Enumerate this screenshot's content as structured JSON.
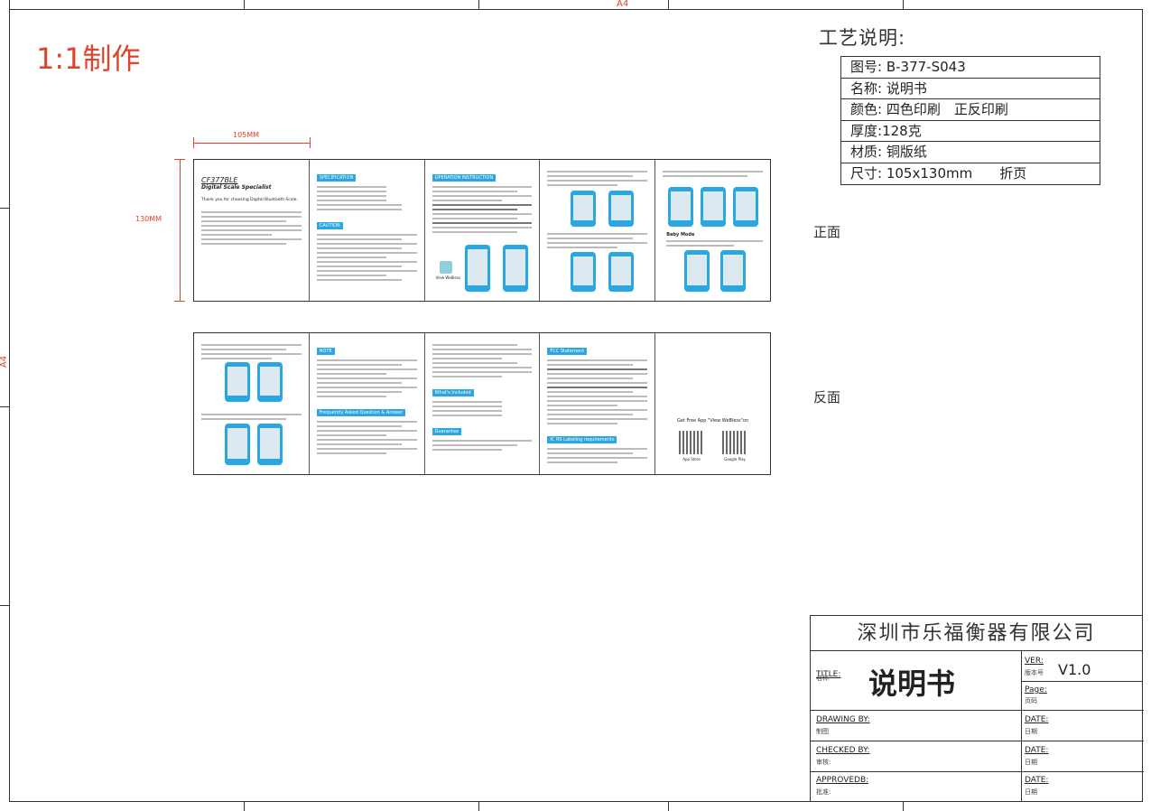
{
  "sheet": {
    "size_marker": "A4",
    "instruction_red": "1:1制作",
    "dim_width": "105MM",
    "dim_height": "130MM"
  },
  "craft": {
    "title": "工艺说明:",
    "rows": [
      {
        "label": "图号:",
        "value": "B-377-S043"
      },
      {
        "label": "名称:",
        "value": "说明书"
      },
      {
        "label": "颜色:",
        "value": "四色印刷　正反印刷"
      },
      {
        "label": "厚度:",
        "value": "128克"
      },
      {
        "label": "材质:",
        "value": "铜版纸"
      },
      {
        "label": "尺寸:",
        "value": "105x130mm　　折页"
      }
    ]
  },
  "sides": {
    "front": "正面",
    "back": "反面"
  },
  "brochure_front": {
    "panel1": {
      "model": "CF377BLE",
      "subtitle": "Digital Scale Specialist",
      "thanks": "Thank you for choosing Digital Bluetooth Scale."
    },
    "panel2": {
      "h1": "SPECIFICATION",
      "h2": "CAUTION"
    },
    "panel3": {
      "h1": "OPERATION INSTRUCTION",
      "app_label": "View WeBless"
    },
    "panel4": {},
    "panel5": {
      "h1": "Baby Mode"
    }
  },
  "brochure_back": {
    "panel2": {
      "h1": "NOTE",
      "h2": "Frequently Asked Question & Answer"
    },
    "panel3": {
      "h1": "What's Included",
      "h2": "Guarantee"
    },
    "panel4": {
      "h1": "FCC Statement",
      "h2": "IC RS Labeling requirements"
    },
    "panel5": {
      "text": "Get Free App \"View WeBless\"on",
      "store1": "App Store",
      "store2": "Google Play"
    }
  },
  "title_block": {
    "company": "深圳市乐福衡器有限公司",
    "title_label": "TITLE:",
    "title_sub": "名称",
    "title_value": "说明书",
    "ver_label": "VER:",
    "ver_sub": "版本号",
    "ver_value": "V1.0",
    "page_label": "Page:",
    "page_sub": "页码",
    "drawing_label": "DRAWING BY:",
    "drawing_sub": "制图",
    "checked_label": "CHECKED BY:",
    "checked_sub": "审核:",
    "approved_label": "APPROVEDB:",
    "approved_sub": "批准:",
    "date_label": "DATE:",
    "date_sub": "日期"
  }
}
